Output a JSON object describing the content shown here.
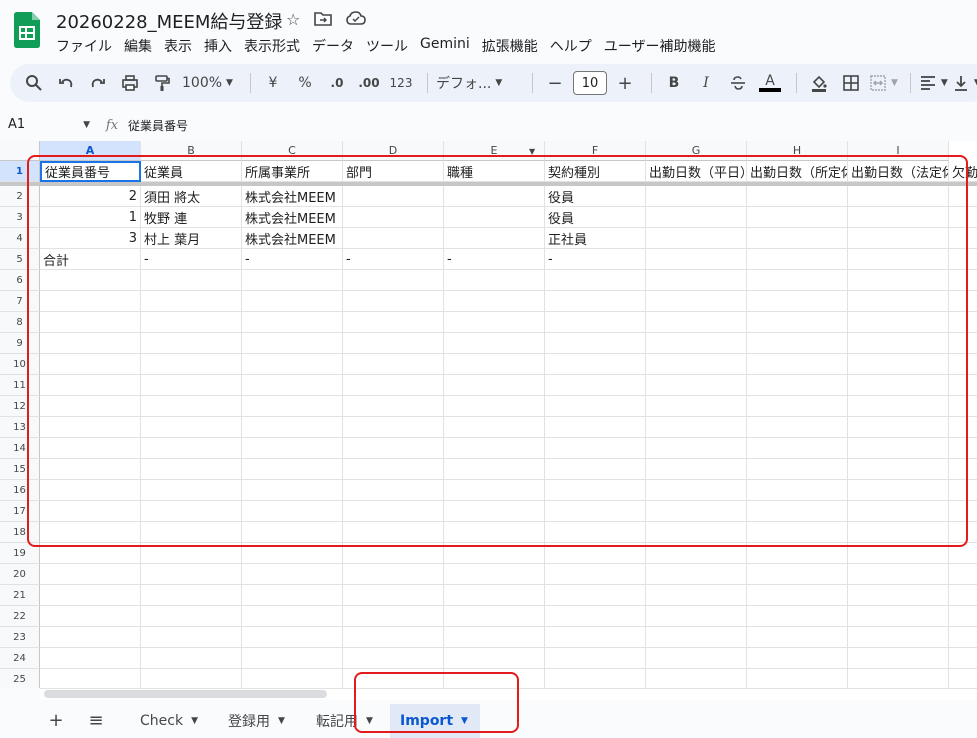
{
  "title": "20260228_MEEM給与登録",
  "menu": [
    "ファイル",
    "編集",
    "表示",
    "挿入",
    "表示形式",
    "データ",
    "ツール",
    "Gemini",
    "拡張機能",
    "ヘルプ",
    "ユーザー補助機能"
  ],
  "toolbar": {
    "zoom": "100%",
    "currency": "¥",
    "percent": "%",
    "dec_decrease": ".0",
    "dec_increase": ".00",
    "format_123": "123",
    "font": "デフォ...",
    "font_size": "10",
    "bold": "B",
    "italic": "I",
    "text_color": "A"
  },
  "formula_bar": {
    "cell_ref": "A1",
    "fx": "fx",
    "content": "従業員番号"
  },
  "columns": [
    "A",
    "B",
    "C",
    "D",
    "E",
    "F",
    "G",
    "H",
    "I"
  ],
  "rows": [
    "1",
    "2",
    "3",
    "4",
    "5",
    "6",
    "7",
    "8",
    "9",
    "10",
    "11",
    "12",
    "13",
    "14",
    "15",
    "16",
    "17",
    "18",
    "19",
    "20",
    "21",
    "22",
    "23",
    "24",
    "25"
  ],
  "table": {
    "headers": [
      "従業員番号",
      "従業員",
      "所属事業所",
      "部門",
      "職種",
      "契約種別",
      "出勤日数（平日）",
      "出勤日数（所定休",
      "出勤日数（法定休",
      "欠勤"
    ],
    "rows": [
      [
        "2",
        "須田 將太",
        "株式会社MEEM",
        "",
        "",
        "役員"
      ],
      [
        "1",
        "牧野 連",
        "株式会社MEEM",
        "",
        "",
        "役員"
      ],
      [
        "3",
        "村上 葉月",
        "株式会社MEEM",
        "",
        "",
        "正社員"
      ],
      [
        "合計",
        "-",
        "-",
        "-",
        "-",
        "-"
      ]
    ]
  },
  "sheets": {
    "add": "+",
    "list": "≡",
    "tabs": [
      "Check",
      "登録用",
      "転記用",
      "Import"
    ],
    "active": "Import"
  },
  "colors": {
    "accent": "#0b57d0",
    "annotation": "#e21c1c",
    "logo": "#0f9d58"
  }
}
